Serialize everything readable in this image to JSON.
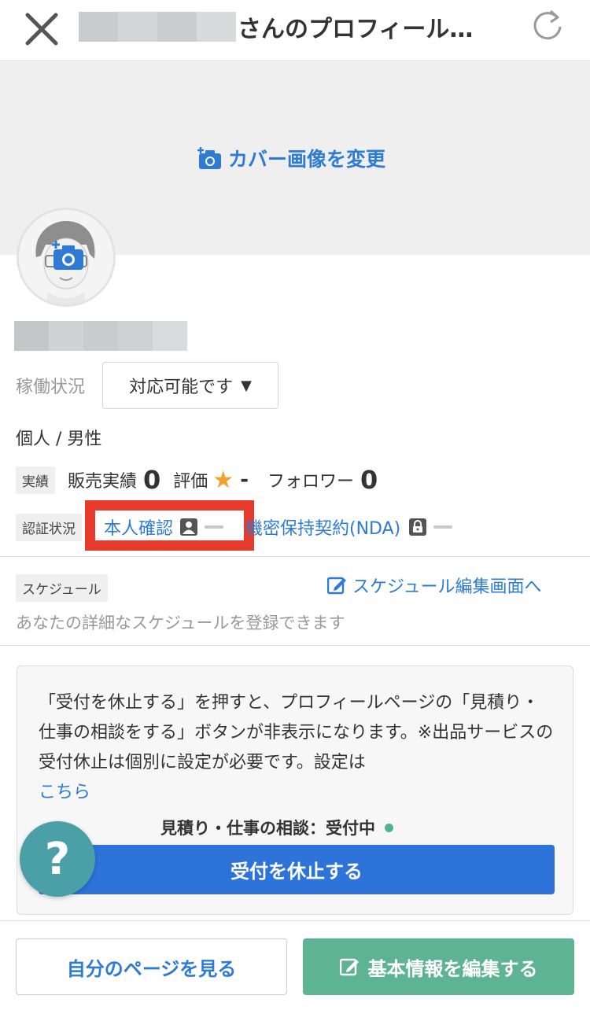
{
  "header": {
    "title_suffix": "さんのプロフィール…",
    "close_icon": "close-icon",
    "refresh_icon": "refresh-icon"
  },
  "cover": {
    "change_label": "カバー画像を変更"
  },
  "profile": {
    "operation_label": "稼働状況",
    "operation_value": "対応可能です",
    "type_gender": "個人 / 男性"
  },
  "stats": {
    "tag": "実績",
    "sales_label": "販売実績",
    "sales_value": "0",
    "rating_label": "評価",
    "rating_value": "-",
    "followers_label": "フォロワー",
    "followers_value": "0"
  },
  "certification": {
    "tag": "認証状況",
    "identity_label": "本人確認",
    "nda_label": "機密保持契約(NDA)"
  },
  "schedule": {
    "tag": "スケジュール",
    "edit_link": "スケジュール編集画面へ",
    "description": "あなたの詳細なスケジュールを登録できます"
  },
  "notice": {
    "text": "「受付を休止する」を押すと、プロフィールページの「見積り・仕事の相談をする」ボタンが非表示になります。※出品サービスの受付休止は個別に設定が必要です。設定は",
    "link": "こちら",
    "status": "見積り・仕事の相談：受付中",
    "stop_button": "受付を休止する"
  },
  "help": {
    "label": "?"
  },
  "footer": {
    "my_page_button": "自分のページを見る",
    "edit_button": "基本情報を編集する"
  },
  "colors": {
    "accent": "#2e7bd6",
    "primary_button": "#2e73d9",
    "edit_button": "#5db394",
    "help_button": "#4b9fa6",
    "highlight": "#e53a2c",
    "star": "#f0a22e"
  }
}
